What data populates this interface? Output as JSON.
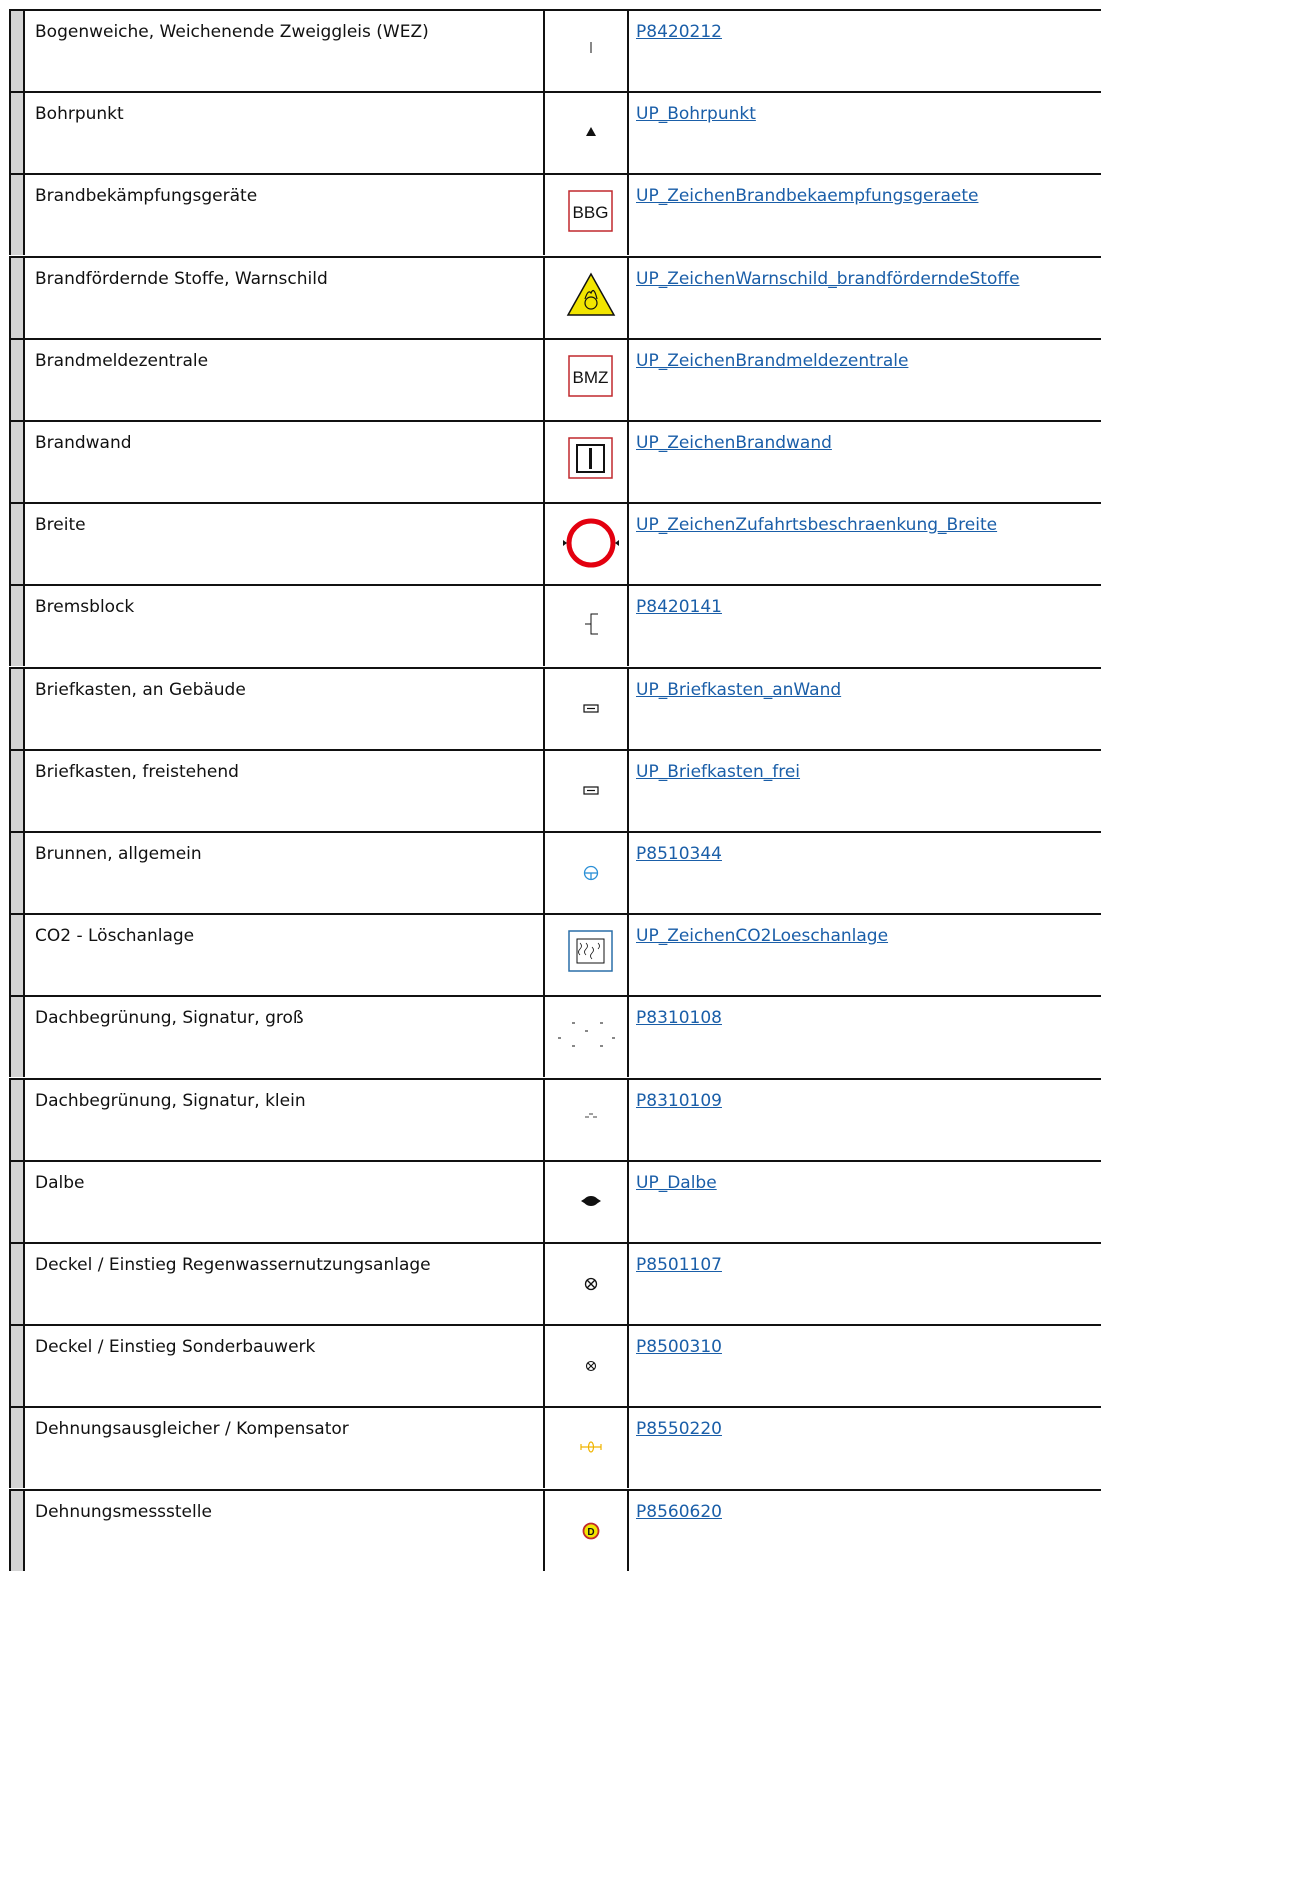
{
  "rows": [
    {
      "name": "Bogenweiche, Weichenende Zweiggleis (WEZ)",
      "code": "P8420212",
      "icon": "vertical-tick-icon"
    },
    {
      "name": "Bohrpunkt",
      "code": "UP_Bohrpunkt",
      "icon": "triangle-icon"
    },
    {
      "name": "Brandbekämpfungsgeräte",
      "code": "UP_ZeichenBrandbekaempfungsgeraete",
      "icon": "bbg-sign-icon",
      "icon_text": "BBG"
    },
    {
      "name": "Brandfördernde Stoffe, Warnschild",
      "code": "UP_ZeichenWarnschild_brandförderndeStoffe",
      "icon": "oxidizer-warning-icon"
    },
    {
      "name": "Brandmeldezentrale",
      "code": "UP_ZeichenBrandmeldezentrale",
      "icon": "bmz-sign-icon",
      "icon_text": "BMZ"
    },
    {
      "name": "Brandwand",
      "code": "UP_ZeichenBrandwand",
      "icon": "firewall-sign-icon"
    },
    {
      "name": "Breite",
      "code": "UP_ZeichenZufahrtsbeschraenkung_Breite",
      "icon": "width-restriction-icon"
    },
    {
      "name": "Bremsblock",
      "code": "P8420141",
      "icon": "brake-block-icon"
    },
    {
      "name": "Briefkasten, an Gebäude",
      "code": "UP_Briefkasten_anWand",
      "icon": "mailbox-wall-icon"
    },
    {
      "name": "Briefkasten, freistehend",
      "code": "UP_Briefkasten_frei",
      "icon": "mailbox-free-icon"
    },
    {
      "name": "Brunnen, allgemein",
      "code": "P8510344",
      "icon": "well-icon"
    },
    {
      "name": "CO2 - Löschanlage",
      "code": "UP_ZeichenCO2Loeschanlage",
      "icon": "co2-extinguisher-icon"
    },
    {
      "name": "Dachbegrünung, Signatur, groß",
      "code": "P8310108",
      "icon": "green-roof-large-icon"
    },
    {
      "name": "Dachbegrünung, Signatur, klein",
      "code": "P8310109",
      "icon": "green-roof-small-icon"
    },
    {
      "name": "Dalbe",
      "code": "UP_Dalbe",
      "icon": "dolphin-icon"
    },
    {
      "name": "Deckel / Einstieg Regenwassernutzungsanlage",
      "code": "P8501107",
      "icon": "manhole-cross-icon"
    },
    {
      "name": "Deckel / Einstieg Sonderbauwerk",
      "code": "P8500310",
      "icon": "manhole-cross-small-icon"
    },
    {
      "name": "Dehnungsausgleicher / Kompensator",
      "code": "P8550220",
      "icon": "compensator-icon"
    },
    {
      "name": "Dehnungsmessstelle",
      "code": "P8560620",
      "icon": "strain-gauge-icon",
      "icon_text": "D"
    }
  ],
  "colors": {
    "link": "#1a5ea8",
    "sign_red": "#c0282d",
    "co2_blue": "#2a6fa8",
    "well_blue": "#2a8fd6",
    "compensator_yellow": "#f0b400",
    "warning_yellow": "#f2e500"
  }
}
